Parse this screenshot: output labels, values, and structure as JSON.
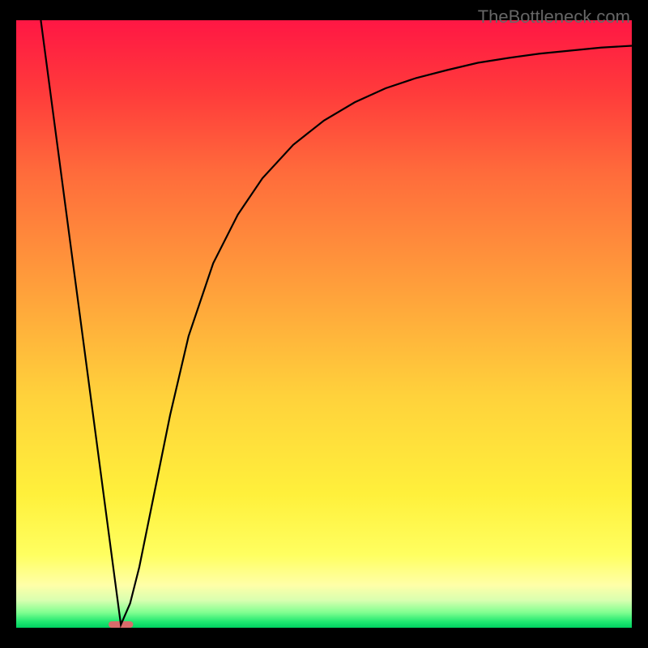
{
  "watermark": "TheBottleneck.com",
  "chart_data": {
    "type": "line",
    "title": "",
    "xlabel": "",
    "ylabel": "",
    "x_range": [
      0,
      100
    ],
    "y_range": [
      0,
      100
    ],
    "marker": {
      "x": 17,
      "width": 4,
      "color": "#d96b6b"
    },
    "curve_points": [
      {
        "x": 4.0,
        "y": 100.0
      },
      {
        "x": 17.0,
        "y": 0.5
      },
      {
        "x": 18.5,
        "y": 4.0
      },
      {
        "x": 20.0,
        "y": 10.0
      },
      {
        "x": 22.0,
        "y": 20.0
      },
      {
        "x": 25.0,
        "y": 35.0
      },
      {
        "x": 28.0,
        "y": 48.0
      },
      {
        "x": 32.0,
        "y": 60.0
      },
      {
        "x": 36.0,
        "y": 68.0
      },
      {
        "x": 40.0,
        "y": 74.0
      },
      {
        "x": 45.0,
        "y": 79.5
      },
      {
        "x": 50.0,
        "y": 83.5
      },
      {
        "x": 55.0,
        "y": 86.5
      },
      {
        "x": 60.0,
        "y": 88.8
      },
      {
        "x": 65.0,
        "y": 90.5
      },
      {
        "x": 70.0,
        "y": 91.8
      },
      {
        "x": 75.0,
        "y": 93.0
      },
      {
        "x": 80.0,
        "y": 93.8
      },
      {
        "x": 85.0,
        "y": 94.5
      },
      {
        "x": 90.0,
        "y": 95.0
      },
      {
        "x": 95.0,
        "y": 95.5
      },
      {
        "x": 100.0,
        "y": 95.8
      }
    ],
    "gradient_stops": [
      {
        "offset": 0.0,
        "color": "#ff1744"
      },
      {
        "offset": 0.12,
        "color": "#ff3b3b"
      },
      {
        "offset": 0.25,
        "color": "#ff6b3b"
      },
      {
        "offset": 0.45,
        "color": "#ffa23b"
      },
      {
        "offset": 0.62,
        "color": "#ffd23b"
      },
      {
        "offset": 0.78,
        "color": "#fff03b"
      },
      {
        "offset": 0.88,
        "color": "#ffff60"
      },
      {
        "offset": 0.93,
        "color": "#ffffa8"
      },
      {
        "offset": 0.955,
        "color": "#d8ffb0"
      },
      {
        "offset": 0.975,
        "color": "#80ff90"
      },
      {
        "offset": 0.99,
        "color": "#20e870"
      },
      {
        "offset": 1.0,
        "color": "#00d060"
      }
    ]
  }
}
